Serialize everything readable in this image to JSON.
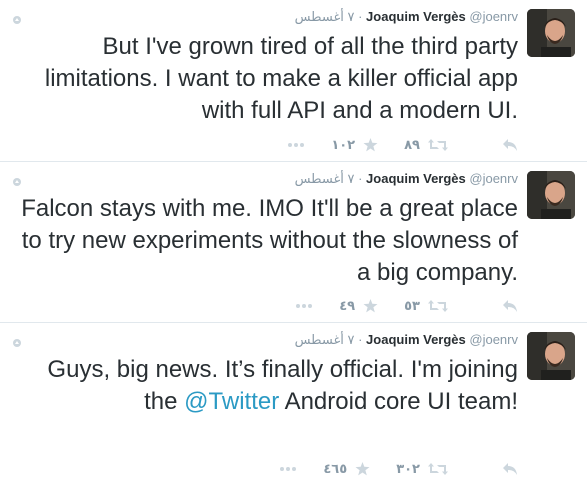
{
  "tweets": [
    {
      "fullname": "Joaquim Vergès",
      "username": "@joenrv",
      "separator": "·",
      "time": "٧ أغسطس",
      "text": "But I've grown tired of all the third party limitations. I want to make a killer official app with full API and a modern UI.",
      "retweets": "٨٩",
      "favorites": "١٠٢"
    },
    {
      "fullname": "Joaquim Vergès",
      "username": "@joenrv",
      "separator": "·",
      "time": "٧ أغسطس",
      "text": "Falcon stays with me. IMO It'll be a great place to try new experiments without the slowness of a big company.",
      "retweets": "٥٣",
      "favorites": "٤٩"
    },
    {
      "fullname": "Joaquim Vergès",
      "username": "@joenrv",
      "separator": "·",
      "time": "٧ أغسطس",
      "text_before": "Guys, big news. It’s finally official. I'm joining the ",
      "mention": "@Twitter",
      "text_after": " Android core UI team!",
      "retweets": "٣٠٢",
      "favorites": "٤٦٥"
    }
  ],
  "icons": {
    "reply": "reply-icon",
    "retweet": "retweet-icon",
    "favorite": "star-icon",
    "more": "more-icon",
    "context": "pin-icon"
  },
  "colors": {
    "text": "#292f33",
    "muted": "#8899a6",
    "link": "#2b9ac4",
    "divider": "#e1e8ed"
  }
}
